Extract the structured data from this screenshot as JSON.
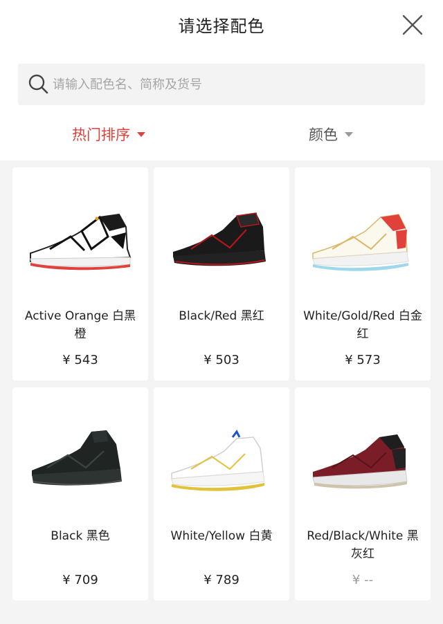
{
  "header": {
    "title": "请选择配色",
    "close_icon": "close-icon"
  },
  "search": {
    "placeholder": "请输入配色名、简称及货号",
    "value": "",
    "icon": "search-icon"
  },
  "filters": {
    "sort_label": "热门排序",
    "color_label": "颜色",
    "active_color": "#e0413a"
  },
  "products": [
    {
      "name": "Active Orange 白黑橙",
      "price": "¥ 543",
      "image": "white-black-orange-sneaker"
    },
    {
      "name": "Black/Red 黑红",
      "price": "¥ 503",
      "image": "black-red-sneaker"
    },
    {
      "name": "White/Gold/Red 白金红",
      "price": "¥ 573",
      "image": "white-gold-red-sneaker"
    },
    {
      "name": "Black 黑色",
      "price": "¥ 709",
      "image": "black-sneaker"
    },
    {
      "name": "White/Yellow 白黄",
      "price": "¥ 789",
      "image": "white-yellow-sneaker"
    },
    {
      "name": "Red/Black/White 黑灰红",
      "price": "¥ --",
      "image": "maroon-black-white-sneaker"
    }
  ]
}
